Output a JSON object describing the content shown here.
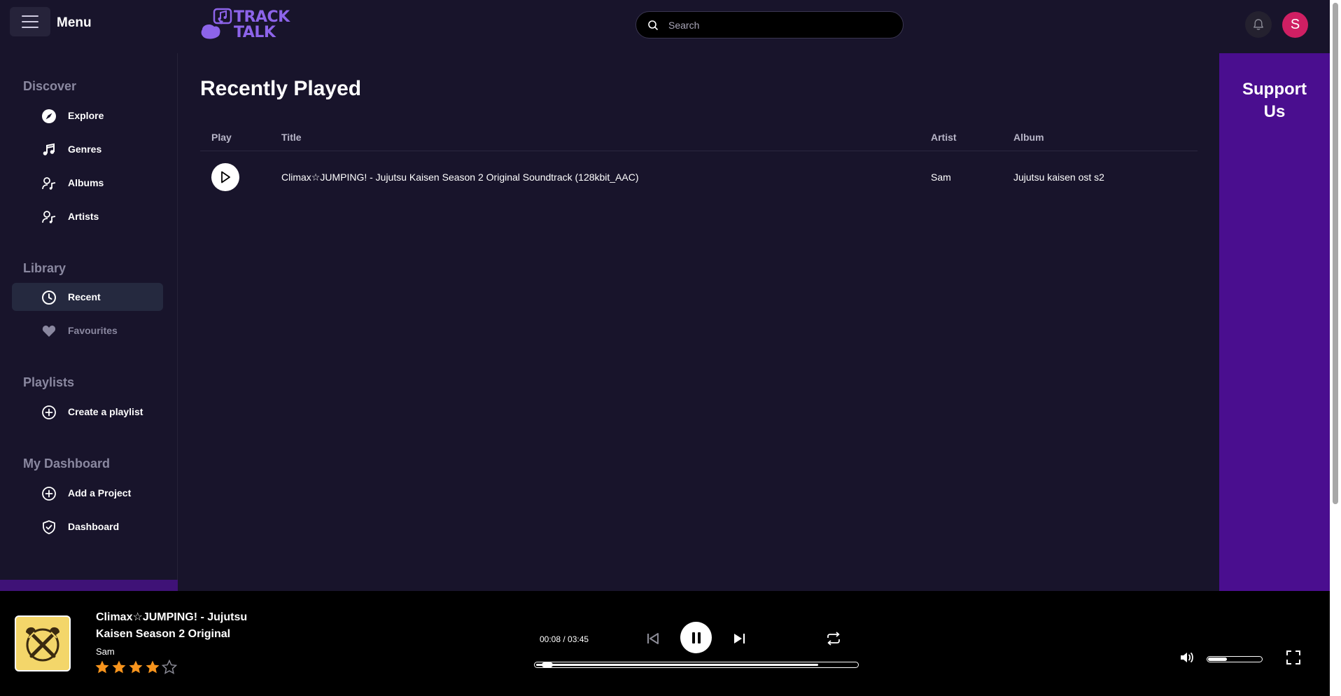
{
  "header": {
    "menu_label": "Menu",
    "logo_line1": "TRACK",
    "logo_line2": "TALK",
    "search_placeholder": "Search",
    "avatar_initial": "S"
  },
  "sidebar": {
    "sections": [
      {
        "title": "Discover",
        "items": [
          {
            "label": "Explore",
            "icon": "compass-icon"
          },
          {
            "label": "Genres",
            "icon": "music-note-icon"
          },
          {
            "label": "Albums",
            "icon": "user-music-icon"
          },
          {
            "label": "Artists",
            "icon": "user-music-icon"
          }
        ]
      },
      {
        "title": "Library",
        "items": [
          {
            "label": "Recent",
            "icon": "clock-icon",
            "active": true
          },
          {
            "label": "Favourites",
            "icon": "heart-icon"
          }
        ]
      },
      {
        "title": "Playlists",
        "items": [
          {
            "label": "Create a playlist",
            "icon": "plus-circle-icon"
          }
        ]
      },
      {
        "title": "My Dashboard",
        "items": [
          {
            "label": "Add a Project",
            "icon": "plus-circle-icon"
          },
          {
            "label": "Dashboard",
            "icon": "shield-check-icon"
          }
        ]
      }
    ]
  },
  "main": {
    "title": "Recently Played",
    "columns": {
      "play": "Play",
      "title": "Title",
      "artist": "Artist",
      "album": "Album"
    },
    "rows": [
      {
        "title": "Climax☆JUMPING! - Jujutsu Kaisen Season 2 Original Soundtrack (128kbit_AAC)",
        "artist": "Sam",
        "album": "Jujutsu kaisen ost s2"
      }
    ]
  },
  "support": {
    "label": "Support\nUs"
  },
  "player": {
    "title": "Climax☆JUMPING! - Jujutsu Kaisen Season 2 Original",
    "artist": "Sam",
    "rating": 4,
    "rating_max": 5,
    "time": "00:08 / 03:45",
    "progress_fraction": 0.036,
    "buffer_fraction": 0.88,
    "volume_fraction": 0.35
  },
  "colors": {
    "background": "#18142b",
    "accent_purple": "#4a0e8f",
    "logo_purple": "#8d64ea",
    "avatar": "#cf1f63",
    "star": "#f7941d"
  }
}
